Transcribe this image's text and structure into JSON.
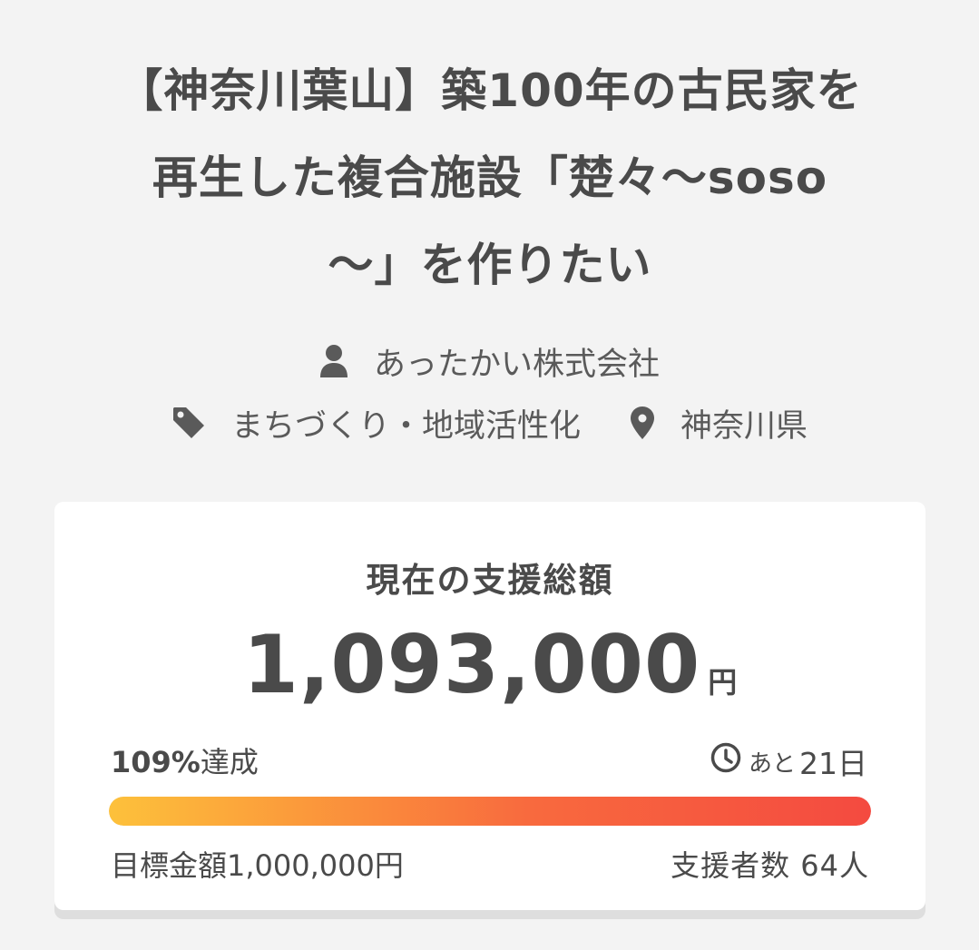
{
  "project": {
    "title_lines": [
      "【神奈川葉山】築100年の古民家を",
      "再生した複合施設「楚々〜soso",
      "〜」を作りたい"
    ],
    "owner": "あったかい株式会社",
    "category": "まちづくり・地域活性化",
    "location": "神奈川県"
  },
  "funding": {
    "heading": "現在の支援総額",
    "amount": "1,093,000",
    "amount_unit": "円",
    "achieved_percent": "109%",
    "achieved_label": "達成",
    "remaining_prefix": "あと",
    "remaining_value": "21日",
    "progress_fraction": 1.09,
    "goal_label": "目標金額1,000,000円",
    "backers_label": "支援者数 64人"
  },
  "icons": {
    "owner": "person-icon",
    "category": "tag-icon",
    "location": "map-pin-icon",
    "remaining": "clock-icon"
  },
  "colors": {
    "text": "#4a4a4a",
    "progress_start": "#fdc13b",
    "progress_end": "#f44a40",
    "background": "#f3f3f3",
    "card": "#ffffff"
  }
}
